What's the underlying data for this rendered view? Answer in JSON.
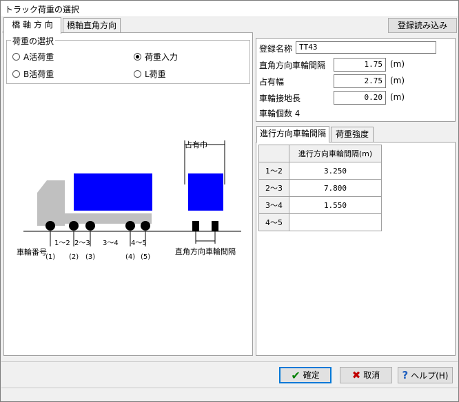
{
  "window": {
    "title": "トラック荷重の選択"
  },
  "tabs": {
    "bridge_axis": "橋 軸 方 向",
    "perpendicular": "橋軸直角方向"
  },
  "toolbar": {
    "load_registered": "登録読み込み"
  },
  "load_selection": {
    "legend": "荷重の選択",
    "options": [
      "A活荷重",
      "B活荷重",
      "荷重入力",
      "L荷重"
    ],
    "selected": "荷重入力"
  },
  "diagram": {
    "occupied_width_label": "占有巾",
    "axle_label": "車輪番号",
    "axle_numbers": [
      "(1)",
      "(2)",
      "(3)",
      "(4)",
      "(5)"
    ],
    "spacing_labels": [
      "1～2",
      "2～3",
      "3～4",
      "4～5"
    ],
    "perpendicular_spacing_label": "直角方向車輪間隔",
    "colors": {
      "cargo": "#0000ff",
      "cab": "#c0c0c0",
      "wheel": "#000000"
    }
  },
  "properties": {
    "reg_name_label": "登録名称",
    "reg_name_value": "TT43",
    "perp_spacing_label": "直角方向車輪間隔",
    "perp_spacing_value": "1.75",
    "occupied_width_label": "占有幅",
    "occupied_width_value": "2.75",
    "contact_length_label": "車輪接地長",
    "contact_length_value": "0.20",
    "unit": "(m)",
    "wheel_count_label": "車輪個数",
    "wheel_count_value": "4"
  },
  "sub_tabs": {
    "travel_spacing": "進行方向車輪間隔",
    "load_strength": "荷重強度"
  },
  "spacing_table": {
    "header": "進行方向車輪間隔(m)",
    "rows": [
      {
        "label": "1～2",
        "value": "3.250"
      },
      {
        "label": "2～3",
        "value": "7.800"
      },
      {
        "label": "3～4",
        "value": "1.550"
      },
      {
        "label": "4～5",
        "value": ""
      }
    ]
  },
  "buttons": {
    "ok": "確定",
    "cancel": "取消",
    "help": "ヘルプ(H)"
  }
}
